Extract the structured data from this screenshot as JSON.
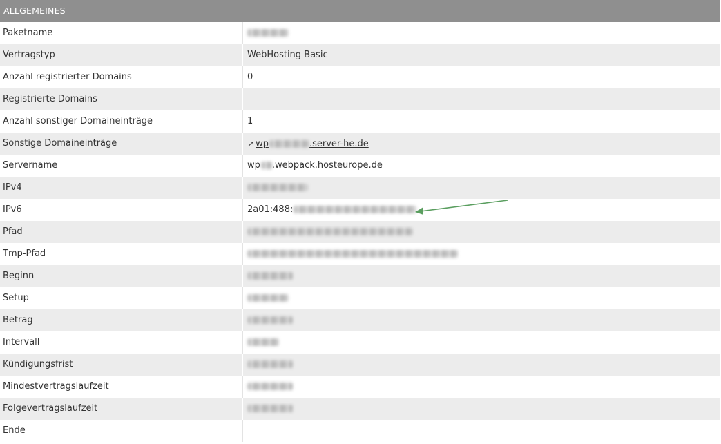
{
  "section": {
    "title": "ALLGEMEINES"
  },
  "rows": [
    {
      "label": "Paketname",
      "value": ""
    },
    {
      "label": "Vertragstyp",
      "value": "WebHosting Basic"
    },
    {
      "label": "Anzahl registrierter Domains",
      "value": "0"
    },
    {
      "label": "Registrierte Domains",
      "value": ""
    },
    {
      "label": "Anzahl sonstiger Domaineinträge",
      "value": "1"
    },
    {
      "label": "Sonstige Domaineinträge",
      "value_prefix": "wp",
      "value_suffix": ".server-he.de"
    },
    {
      "label": "Servername",
      "value_prefix": "wp",
      "value_suffix": ".webpack.hosteurope.de"
    },
    {
      "label": "IPv4",
      "value": ""
    },
    {
      "label": "IPv6",
      "value_prefix": "2a01:488:"
    },
    {
      "label": "Pfad",
      "value": ""
    },
    {
      "label": "Tmp-Pfad",
      "value": ""
    },
    {
      "label": "Beginn",
      "value": ""
    },
    {
      "label": "Setup",
      "value": ""
    },
    {
      "label": "Betrag",
      "value": ""
    },
    {
      "label": "Intervall",
      "value": ""
    },
    {
      "label": "Kündigungsfrist",
      "value": ""
    },
    {
      "label": "Mindestvertragslaufzeit",
      "value": ""
    },
    {
      "label": "Folgevertragslaufzeit",
      "value": ""
    },
    {
      "label": "Ende",
      "value": ""
    }
  ],
  "icons": {
    "external_link": "north-east-arrow-icon"
  },
  "colors": {
    "header_bg": "#8f8f8f",
    "row_alt_bg": "#ececec",
    "annotation_arrow": "#5a9e5f"
  }
}
